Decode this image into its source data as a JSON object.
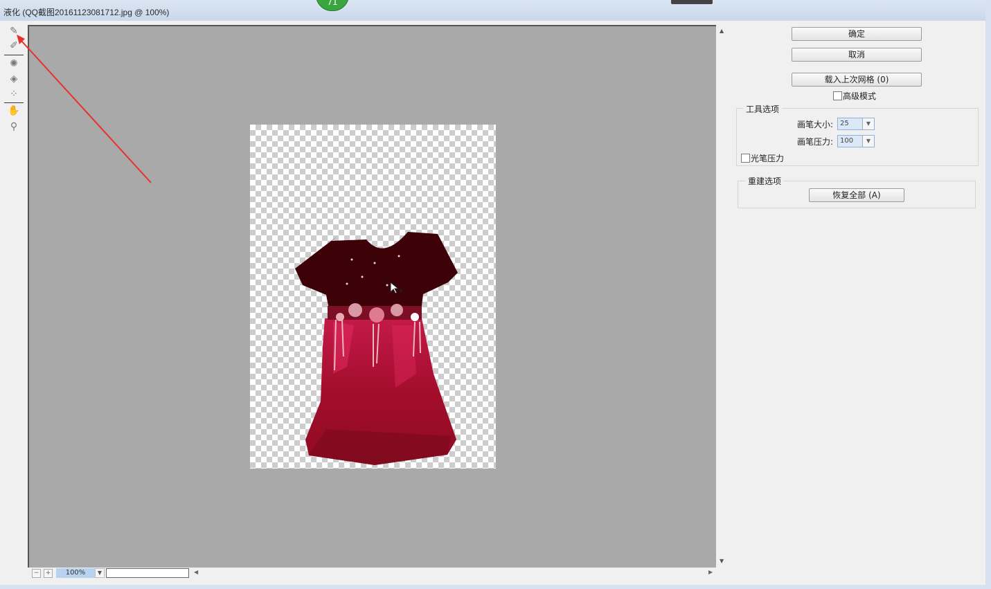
{
  "window": {
    "title": "液化 (QQ截图20161123081712.jpg @ 100%)",
    "badge_text": "71"
  },
  "tools": [
    {
      "name": "forward-warp-tool",
      "glyph": "✎"
    },
    {
      "name": "reconstruct-tool",
      "glyph": "✐"
    },
    {
      "name": "pucker-tool",
      "glyph": "✺"
    },
    {
      "name": "bloat-tool",
      "glyph": "◈"
    },
    {
      "name": "push-left-tool",
      "glyph": "⁘"
    },
    {
      "name": "hand-tool",
      "glyph": "✋"
    },
    {
      "name": "zoom-tool",
      "glyph": "⚲"
    }
  ],
  "zoom": {
    "minus": "−",
    "plus": "+",
    "value": "100%"
  },
  "panel": {
    "ok": "确定",
    "cancel": "取消",
    "load_last_mesh": "载入上次网格 (0)",
    "advanced_mode": "高级模式",
    "tool_options": {
      "legend": "工具选项",
      "brush_size_label": "画笔大小:",
      "brush_size_value": "25",
      "brush_pressure_label": "画笔压力:",
      "brush_pressure_value": "100",
      "stylus_pressure": "光笔压力"
    },
    "reconstruct_options": {
      "legend": "重建选项",
      "restore_all": "恢复全部 (A)"
    }
  }
}
